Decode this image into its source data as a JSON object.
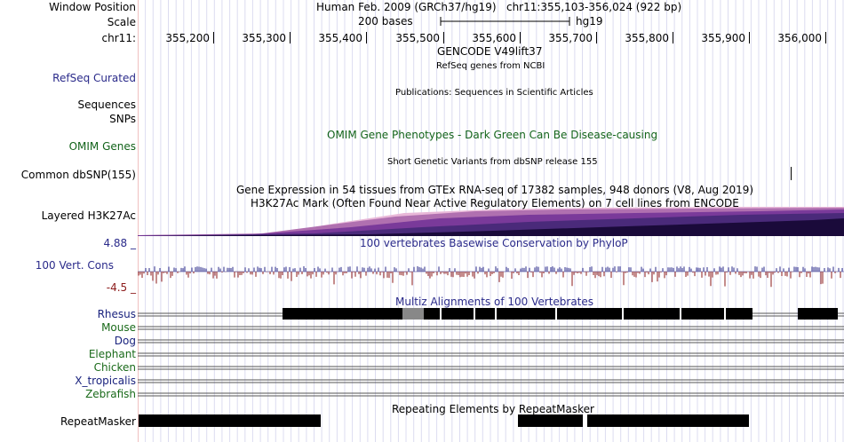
{
  "window_position": {
    "label": "Window Position",
    "assembly": "Human Feb. 2009 (GRCh37/hg19)",
    "location": "chr11:355,103-356,024 (922 bp)"
  },
  "scale": {
    "label": "Scale",
    "bar_label": "200 bases",
    "db": "hg19"
  },
  "ruler": {
    "chrom_label": "chr11:",
    "ticks": [
      "355,200",
      "355,300",
      "355,400",
      "355,500",
      "355,600",
      "355,700",
      "355,800",
      "355,900",
      "356,000"
    ]
  },
  "tracks": {
    "gencode": {
      "title": "GENCODE V49lift37"
    },
    "refseq": {
      "label": "RefSeq Curated",
      "title": "RefSeq genes from NCBI"
    },
    "publications": {
      "title": "Publications: Sequences in Scientific Articles"
    },
    "sequences": {
      "label": "Sequences"
    },
    "snps": {
      "label": "SNPs"
    },
    "omim": {
      "label": "OMIM Genes",
      "title": "OMIM Gene Phenotypes - Dark Green Can Be Disease-causing"
    },
    "dbsnp": {
      "label": "Common dbSNP(155)",
      "title": "Short Genetic Variants from dbSNP release 155"
    },
    "gtex": {
      "title": "Gene Expression in 54 tissues from GTEx RNA-seq of 17382 samples, 948 donors (V8, Aug 2019)"
    },
    "h3k27ac": {
      "label": "Layered H3K27Ac",
      "title": "H3K27Ac Mark (Often Found Near Active Regulatory Elements) on 7 cell lines from ENCODE"
    },
    "phylop": {
      "label": "100 Vert. Cons",
      "max": "4.88 _",
      "min": "-4.5 _",
      "title": "100 vertebrates Basewise Conservation by PhyloP"
    },
    "multiz": {
      "title": "Multiz Alignments of 100 Vertebrates",
      "species": [
        {
          "name": "Rhesus",
          "color": "#1a237e"
        },
        {
          "name": "Mouse",
          "color": "#1a6a1a"
        },
        {
          "name": "Dog",
          "color": "#1a237e"
        },
        {
          "name": "Elephant",
          "color": "#1a6a1a"
        },
        {
          "name": "Chicken",
          "color": "#1a6a1a"
        },
        {
          "name": "X_tropicalis",
          "color": "#1a237e"
        },
        {
          "name": "Zebrafish",
          "color": "#1a6a1a"
        }
      ]
    },
    "repeatmasker": {
      "label": "RepeatMasker",
      "title": "Repeating Elements by RepeatMasker"
    }
  },
  "colors": {
    "grid": "#dcdcf0",
    "left_edge": "#f0c0c0",
    "label_blue": "#2a2a8a",
    "label_green": "#12631a",
    "phylop_red": "#8b1a1a",
    "h3k27ac_dark": "#1a0a3a",
    "h3k27ac_mid": "#5a2a8a",
    "h3k27ac_light": "#c080c0"
  }
}
